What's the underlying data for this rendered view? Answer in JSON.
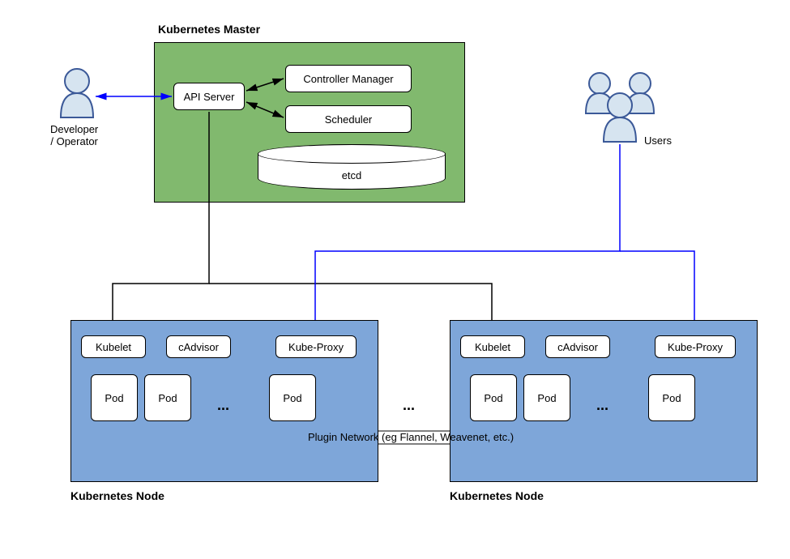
{
  "master": {
    "title": "Kubernetes Master",
    "api_server": "API Server",
    "controller_manager": "Controller Manager",
    "scheduler": "Scheduler",
    "etcd": "etcd"
  },
  "developer": {
    "label": "Developer\n/ Operator"
  },
  "users": {
    "label": "Users"
  },
  "node1": {
    "title": "Kubernetes Node",
    "kubelet": "Kubelet",
    "cadvisor": "cAdvisor",
    "kubeproxy": "Kube-Proxy",
    "pod": "Pod"
  },
  "node2": {
    "title": "Kubernetes Node",
    "kubelet": "Kubelet",
    "cadvisor": "cAdvisor",
    "kubeproxy": "Kube-Proxy",
    "pod": "Pod"
  },
  "plugin_network": "Plugin Network (eg Flannel, Weavenet, etc.)",
  "ellipsis": "..."
}
